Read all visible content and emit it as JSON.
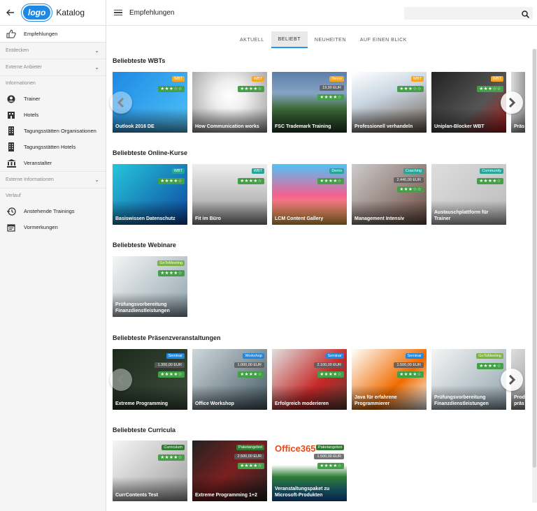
{
  "sidebar": {
    "brand": "Katalog",
    "logo": "logo",
    "items_top": [
      {
        "label": "Empfehlungen",
        "icon": "thumbs-up-icon"
      }
    ],
    "sections": {
      "entdecken": "Entdecken",
      "externe_anbieter": "Externe Anbieter",
      "informationen": "Informationen",
      "externe_informationen": "Externe Informationen",
      "verlauf": "Verlauf"
    },
    "info_items": [
      {
        "label": "Trainer",
        "icon": "person-icon"
      },
      {
        "label": "Hotels",
        "icon": "hotel-icon"
      },
      {
        "label": "Tagungsstätten Organisationen",
        "icon": "building-icon"
      },
      {
        "label": "Tagungsstätten Hotels",
        "icon": "building-icon"
      },
      {
        "label": "Veranstalter",
        "icon": "institution-icon"
      }
    ],
    "verlauf_items": [
      {
        "label": "Anstehende Trainings",
        "icon": "history-icon"
      },
      {
        "label": "Vormerkungen",
        "icon": "calendar-icon"
      }
    ]
  },
  "topbar": {
    "title": "Empfehlungen",
    "search_placeholder": ""
  },
  "tabs": [
    "AKTUELL",
    "BELIEBT",
    "NEUHEITEN",
    "AUF EINEN BLICK"
  ],
  "active_tab": "BELIEBT",
  "colors": {
    "accent": "#2196f3",
    "green": "#43a047",
    "orange": "#f5a623",
    "teal": "#26a69a",
    "blue": "#1e88e5"
  },
  "sections": [
    {
      "title": "Beliebteste WBTs",
      "cards": [
        {
          "title": "Outlook 2016 DE",
          "badge": "WBT",
          "badge_color": "#f5a623",
          "price": "",
          "stars": "★★★☆☆"
        },
        {
          "title": "How Communication works",
          "badge": "WBT",
          "badge_color": "#f5a623",
          "price": "",
          "stars": "★★★★☆"
        },
        {
          "title": "FSC Trademark Training",
          "badge": "Demo",
          "badge_color": "#f5a623",
          "price": "19,90 EUR",
          "stars": "★★★★☆"
        },
        {
          "title": "Professionell verhandeln",
          "badge": "WBT",
          "badge_color": "#f5a623",
          "price": "",
          "stars": "★★★☆☆"
        },
        {
          "title": "Uniplan-Blocker WBT",
          "badge": "WBT",
          "badge_color": "#f5a623",
          "price": "",
          "stars": "★★★☆☆"
        },
        {
          "title": "Präs",
          "badge": "",
          "badge_color": "",
          "price": "",
          "stars": ""
        }
      ]
    },
    {
      "title": "Beliebteste Online-Kurse",
      "cards": [
        {
          "title": "Basiswissen Datenschutz",
          "badge": "WBT",
          "badge_color": "#26a69a",
          "price": "",
          "stars": "★★★★☆"
        },
        {
          "title": "Fit im Büro",
          "badge": "WBT",
          "badge_color": "#26a69a",
          "price": "",
          "stars": "★★★★☆"
        },
        {
          "title": "LCM Content Gallery",
          "badge": "Demo",
          "badge_color": "#26a69a",
          "price": "",
          "stars": "★★★★☆"
        },
        {
          "title": "Management Intensiv",
          "badge": "Coaching",
          "badge_color": "#26a69a",
          "price": "2.440,00 EUR",
          "stars": "★★★☆☆"
        },
        {
          "title": "Austauschplattform für Trainer",
          "badge": "Community",
          "badge_color": "#26a69a",
          "price": "",
          "stars": "★★★★☆"
        }
      ]
    },
    {
      "title": "Beliebteste Webinare",
      "cards": [
        {
          "title": "Prüfungsvorbereitung Finanzdienstleistungen",
          "badge": "GoToMeeting",
          "badge_color": "#7cb342",
          "price": "",
          "stars": "★★★★☆"
        }
      ]
    },
    {
      "title": "Beliebteste Präsenzveranstaltungen",
      "cards": [
        {
          "title": "Extreme Programming",
          "badge": "Seminar",
          "badge_color": "#1e88e5",
          "price": "1.300,00 EUR",
          "stars": "★★★★☆"
        },
        {
          "title": "Office Workshop",
          "badge": "Workshop",
          "badge_color": "#1e88e5",
          "price": "1.000,00 EUR",
          "stars": "★★★★☆"
        },
        {
          "title": "Erfolgreich moderieren",
          "badge": "Seminar",
          "badge_color": "#1e88e5",
          "price": "2.100,00 EUR",
          "stars": "★★★★☆"
        },
        {
          "title": "Java für erfahrene Programmierer",
          "badge": "Seminar",
          "badge_color": "#1e88e5",
          "price": "1.500,00 EUR",
          "stars": "★★★★☆"
        },
        {
          "title": "Prüfungsvorbereitung Finanzdienstleistungen",
          "badge": "GoToMeeting",
          "badge_color": "#7cb342",
          "price": "",
          "stars": "★★★★☆"
        },
        {
          "title": "Prod präs",
          "badge": "",
          "badge_color": "",
          "price": "",
          "stars": ""
        }
      ]
    },
    {
      "title": "Beliebteste Curricula",
      "cards": [
        {
          "title": "CurrContents Test",
          "badge": "Curriculum",
          "badge_color": "#2e7d32",
          "price": "",
          "stars": "★★★★☆"
        },
        {
          "title": "Extreme Programming 1+2",
          "badge": "Paketangebot",
          "badge_color": "#2e7d32",
          "price": "2.500,00 EUR",
          "stars": "★★★★☆"
        },
        {
          "title": "Veranstaltungspaket zu Microsoft-Produkten",
          "badge": "Paketangebot",
          "badge_color": "#2e7d32",
          "price": "1.500,00 EUR",
          "stars": "★★★★☆",
          "img_text": "Office365"
        }
      ]
    }
  ]
}
